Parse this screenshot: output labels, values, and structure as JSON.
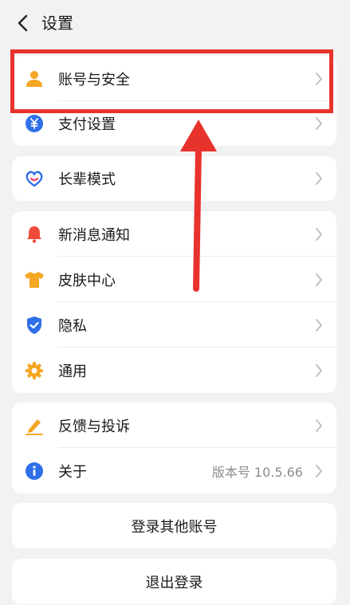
{
  "header": {
    "title": "设置"
  },
  "groups": {
    "account": {
      "items": [
        {
          "label": "账号与安全",
          "icon": "person-icon"
        },
        {
          "label": "支付设置",
          "icon": "yen-icon"
        }
      ]
    },
    "elder": {
      "items": [
        {
          "label": "长辈模式",
          "icon": "heart-hands-icon"
        }
      ]
    },
    "general": {
      "items": [
        {
          "label": "新消息通知",
          "icon": "bell-icon"
        },
        {
          "label": "皮肤中心",
          "icon": "tshirt-icon"
        },
        {
          "label": "隐私",
          "icon": "shield-check-icon"
        },
        {
          "label": "通用",
          "icon": "gear-icon"
        }
      ]
    },
    "about": {
      "items": [
        {
          "label": "反馈与投诉",
          "icon": "pencil-icon"
        },
        {
          "label": "关于",
          "icon": "info-icon",
          "value": "版本号 10.5.66"
        }
      ]
    }
  },
  "buttons": {
    "switch_account": "登录其他账号",
    "logout": "退出登录"
  },
  "colors": {
    "highlight": "#e8322c",
    "orange": "#f5a623",
    "blue": "#2f6fe8",
    "red": "#f04a3a"
  }
}
